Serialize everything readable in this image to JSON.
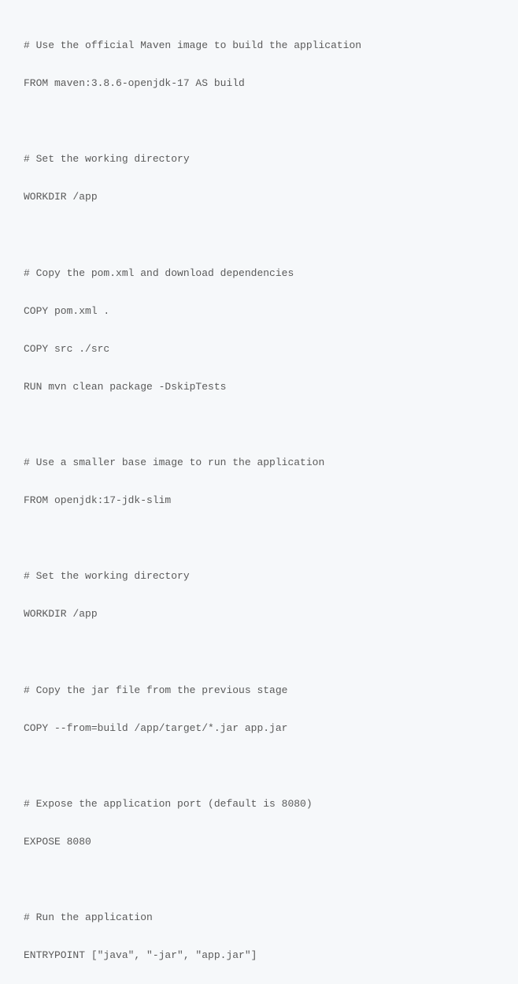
{
  "code": {
    "lines": [
      "# Use the official Maven image to build the application",
      "FROM maven:3.8.6-openjdk-17 AS build",
      "",
      "# Set the working directory",
      "WORKDIR /app",
      "",
      "# Copy the pom.xml and download dependencies",
      "COPY pom.xml .",
      "COPY src ./src",
      "RUN mvn clean package -DskipTests",
      "",
      "# Use a smaller base image to run the application",
      "FROM openjdk:17-jdk-slim",
      "",
      "# Set the working directory",
      "WORKDIR /app",
      "",
      "# Copy the jar file from the previous stage",
      "COPY --from=build /app/target/*.jar app.jar",
      "",
      "# Expose the application port (default is 8080)",
      "EXPOSE 8080",
      "",
      "# Run the application",
      "ENTRYPOINT [\"java\", \"-jar\", \"app.jar\"]"
    ]
  }
}
